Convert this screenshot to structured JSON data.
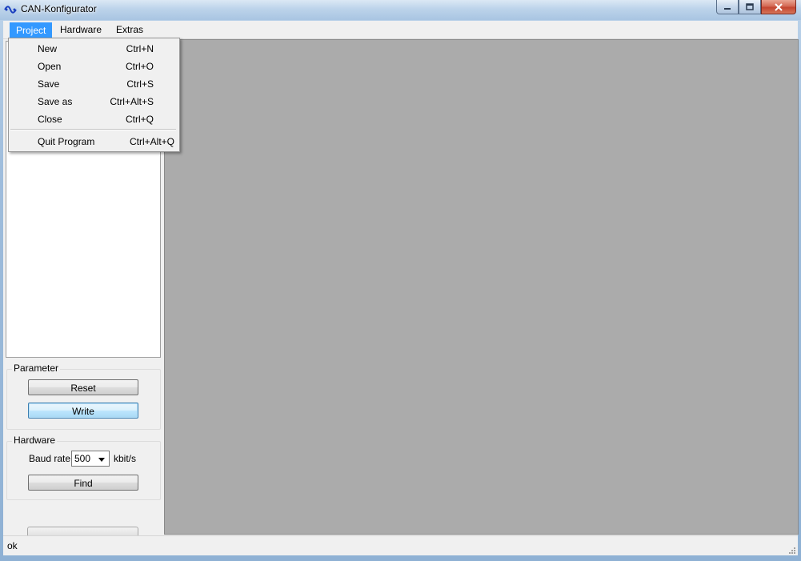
{
  "window": {
    "title": "CAN-Konfigurator",
    "icon": "can-bus-icon"
  },
  "menubar": {
    "items": [
      {
        "label": "Project",
        "active": true
      },
      {
        "label": "Hardware",
        "active": false
      },
      {
        "label": "Extras",
        "active": false
      }
    ]
  },
  "project_menu": {
    "items": [
      {
        "label": "New",
        "shortcut": "Ctrl+N"
      },
      {
        "label": "Open",
        "shortcut": "Ctrl+O"
      },
      {
        "label": "Save",
        "shortcut": "Ctrl+S"
      },
      {
        "label": "Save as",
        "shortcut": "Ctrl+Alt+S"
      },
      {
        "label": "Close",
        "shortcut": "Ctrl+Q"
      },
      {
        "label": "Quit Program",
        "shortcut": "Ctrl+Alt+Q"
      }
    ]
  },
  "parameter_group": {
    "title": "Parameter",
    "reset_label": "Reset",
    "write_label": "Write"
  },
  "hardware_group": {
    "title": "Hardware",
    "baud_label": "Baud rate",
    "baud_value": "500",
    "baud_unit": "kbit/s",
    "find_label": "Find"
  },
  "statusbar": {
    "text": "ok"
  },
  "colors": {
    "menu_highlight": "#3399ff",
    "main_area": "#ababab"
  }
}
